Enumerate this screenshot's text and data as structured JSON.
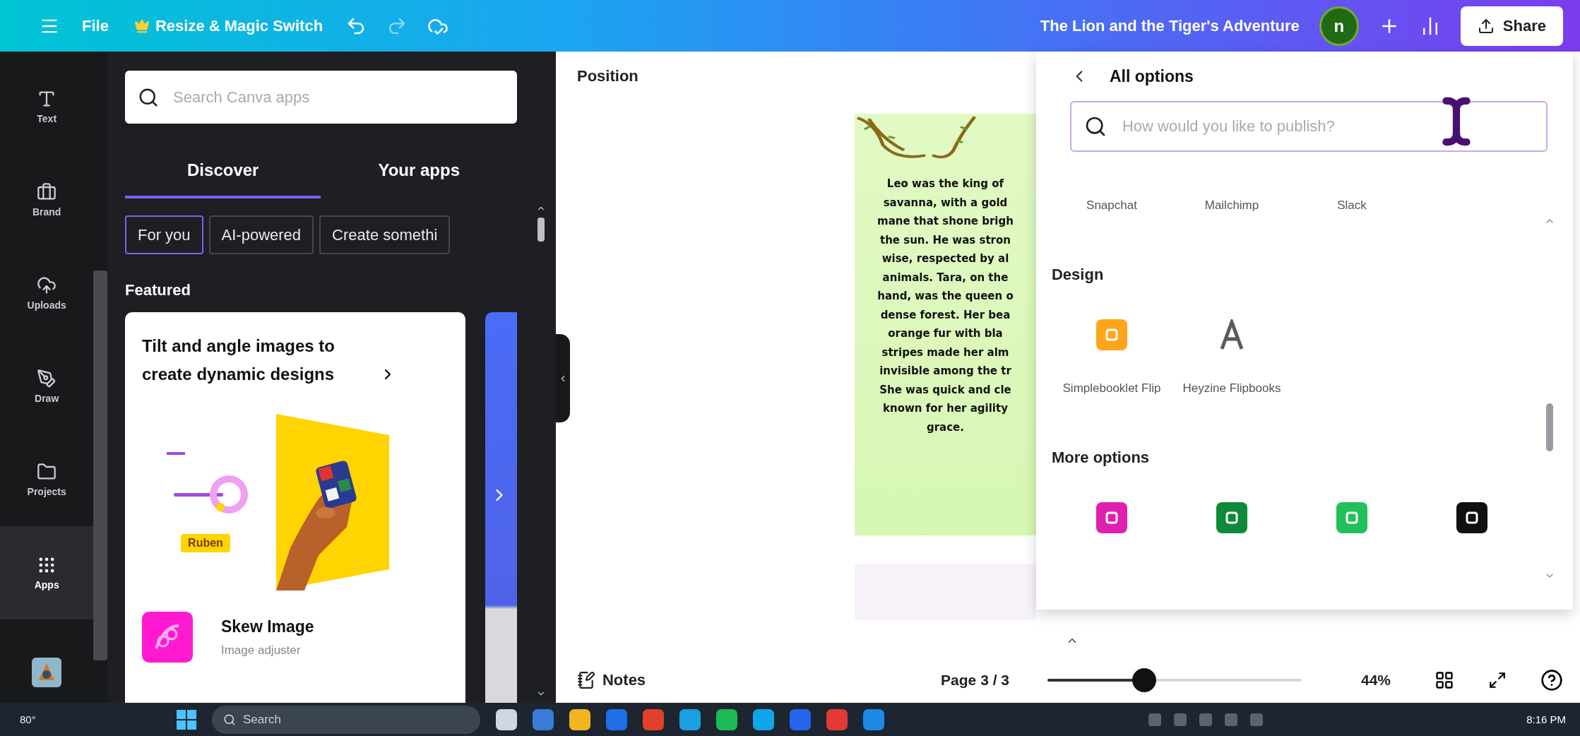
{
  "topbar": {
    "file": "File",
    "resize": "Resize & Magic Switch",
    "title": "The Lion and the Tiger's Adventure",
    "avatar": "n",
    "share": "Share"
  },
  "rail": [
    {
      "label": "Text",
      "selected": false
    },
    {
      "label": "Brand",
      "selected": false
    },
    {
      "label": "Uploads",
      "selected": false
    },
    {
      "label": "Draw",
      "selected": false
    },
    {
      "label": "Projects",
      "selected": false
    },
    {
      "label": "Apps",
      "selected": true
    }
  ],
  "apps_panel": {
    "search": {
      "placeholder": "Search Canva apps"
    },
    "tabs": [
      {
        "label": "Discover",
        "selected": true
      },
      {
        "label": "Your apps",
        "selected": false
      }
    ],
    "chips": [
      {
        "label": "For you",
        "selected": true
      },
      {
        "label": "AI-powered",
        "selected": false
      },
      {
        "label": "Create somethi",
        "selected": false
      }
    ],
    "section": "Featured",
    "card": {
      "title": "Tilt and angle images to create dynamic designs",
      "tag": "Ruben",
      "app_name": "Skew Image",
      "app_subtitle": "Image adjuster"
    }
  },
  "canvas": {
    "label": "Position",
    "page_text": [
      "Leo was the king of",
      "savanna, with a gold",
      "mane that shone brigh",
      "the sun. He was stron",
      "wise, respected by al",
      "animals. Tara, on the",
      "hand, was the queen o",
      "dense forest. Her bea",
      "orange fur with bla",
      "stripes made her alm",
      "invisible among the tr",
      "She was quick and cle",
      "known for her agility",
      "grace."
    ]
  },
  "publish": {
    "title": "All options",
    "search": {
      "placeholder": "How would you like to publish?"
    },
    "top_row": [
      "Snapchat",
      "Mailchimp",
      "Slack"
    ],
    "sections": [
      {
        "heading": "Design",
        "items": [
          {
            "label": "Simplebooklet Flip",
            "color": "#ffa41b"
          },
          {
            "label": "Heyzine Flipbooks",
            "color": "#5a5a5a"
          }
        ]
      },
      {
        "heading": "More options",
        "items": [
          {
            "color": "#e020b0"
          },
          {
            "color": "#0e8a3a"
          },
          {
            "color": "#22c05a"
          },
          {
            "color": "#111111"
          }
        ]
      }
    ]
  },
  "bottom": {
    "notes": "Notes",
    "page": "Page 3 / 3",
    "zoom": {
      "level": 0.38
    },
    "zoom_reading": "44%"
  },
  "taskbar": {
    "weather": "80°",
    "search": "Search",
    "time": "8:16 PM"
  }
}
